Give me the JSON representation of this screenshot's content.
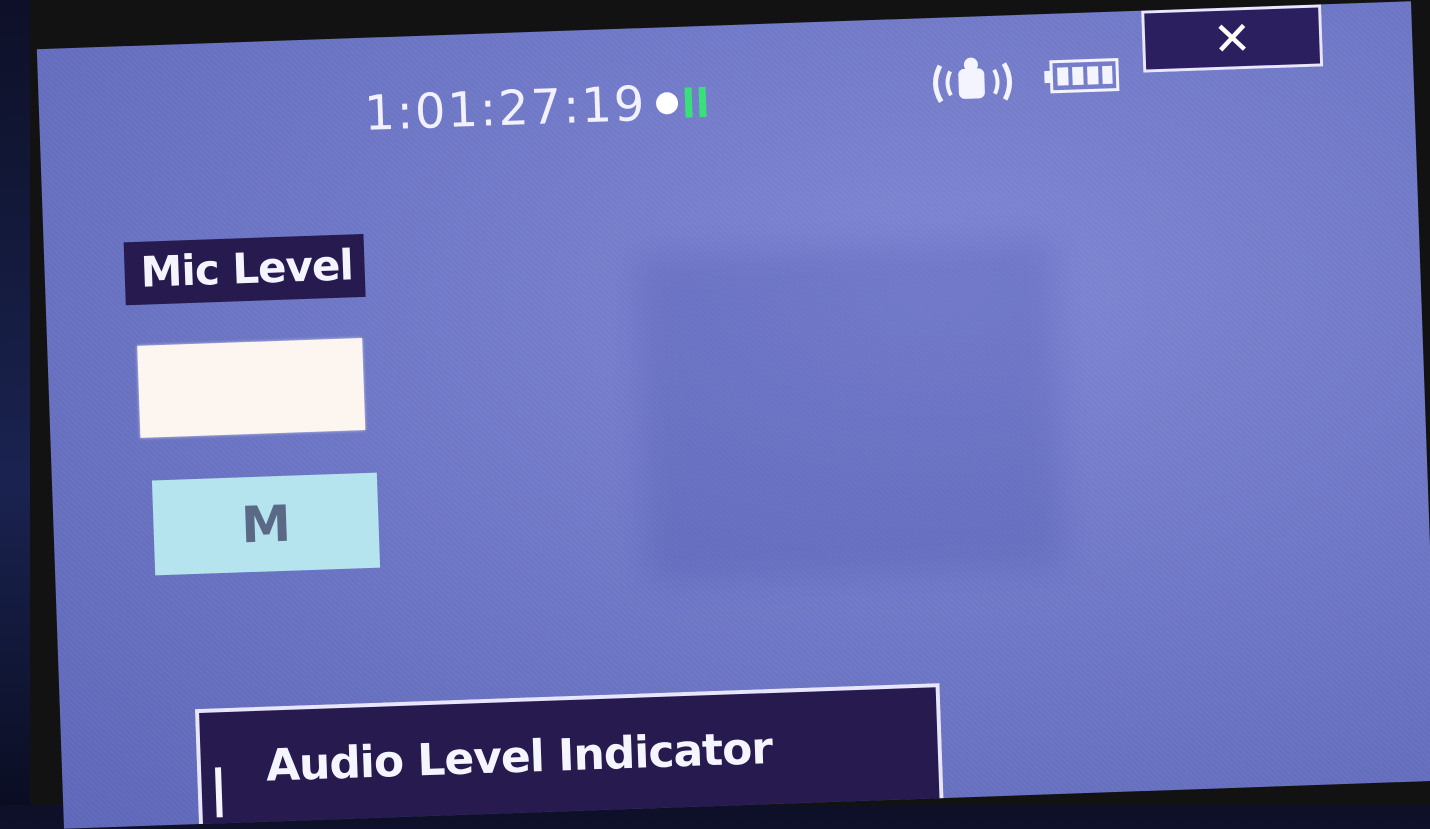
{
  "osd": {
    "timecode": "1:01:27:19",
    "rec_status": "record-pause",
    "close_label": "✕"
  },
  "icons": {
    "stabilizer": "image-stabilizer-icon",
    "battery": "battery-icon",
    "record": "record-dot-icon",
    "pause": "pause-icon"
  },
  "mic_level": {
    "title": "Mic Level",
    "mode_label": "M"
  },
  "audio_level": {
    "title": "Audio Level Indicator"
  },
  "colors": {
    "screen_bg": "#6f78c6",
    "panel": "#261a4f",
    "meter": "#fdf6f0",
    "mode_button": "#b5e4ef",
    "pause": "#39e07a"
  }
}
